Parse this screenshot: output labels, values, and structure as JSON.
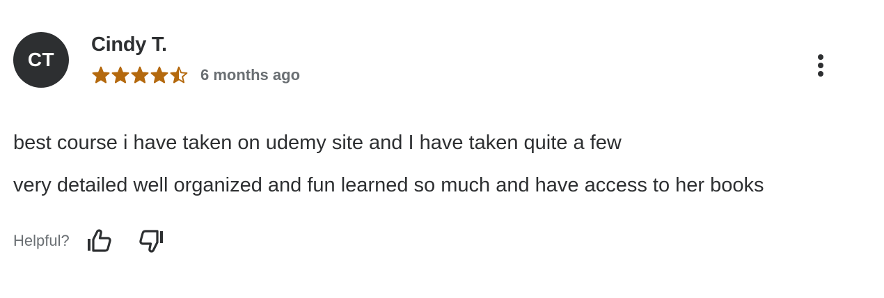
{
  "review": {
    "avatar_initials": "CT",
    "reviewer_name": "Cindy T.",
    "rating": 4.5,
    "rating_max": 5,
    "date": "6 months ago",
    "text_lines": [
      "best course i have taken on udemy site and I have taken quite a few",
      "very detailed well organized and fun learned so much and have access to her books"
    ],
    "helpful_label": "Helpful?"
  },
  "icons": {
    "star": "star-icon",
    "more": "more-vertical-icon",
    "thumbs_up": "thumbs-up-icon",
    "thumbs_down": "thumbs-down-icon"
  },
  "colors": {
    "star": "#b4690e",
    "avatar_bg": "#2d2f31",
    "text": "#2d2f31",
    "muted": "#6a6f73"
  }
}
